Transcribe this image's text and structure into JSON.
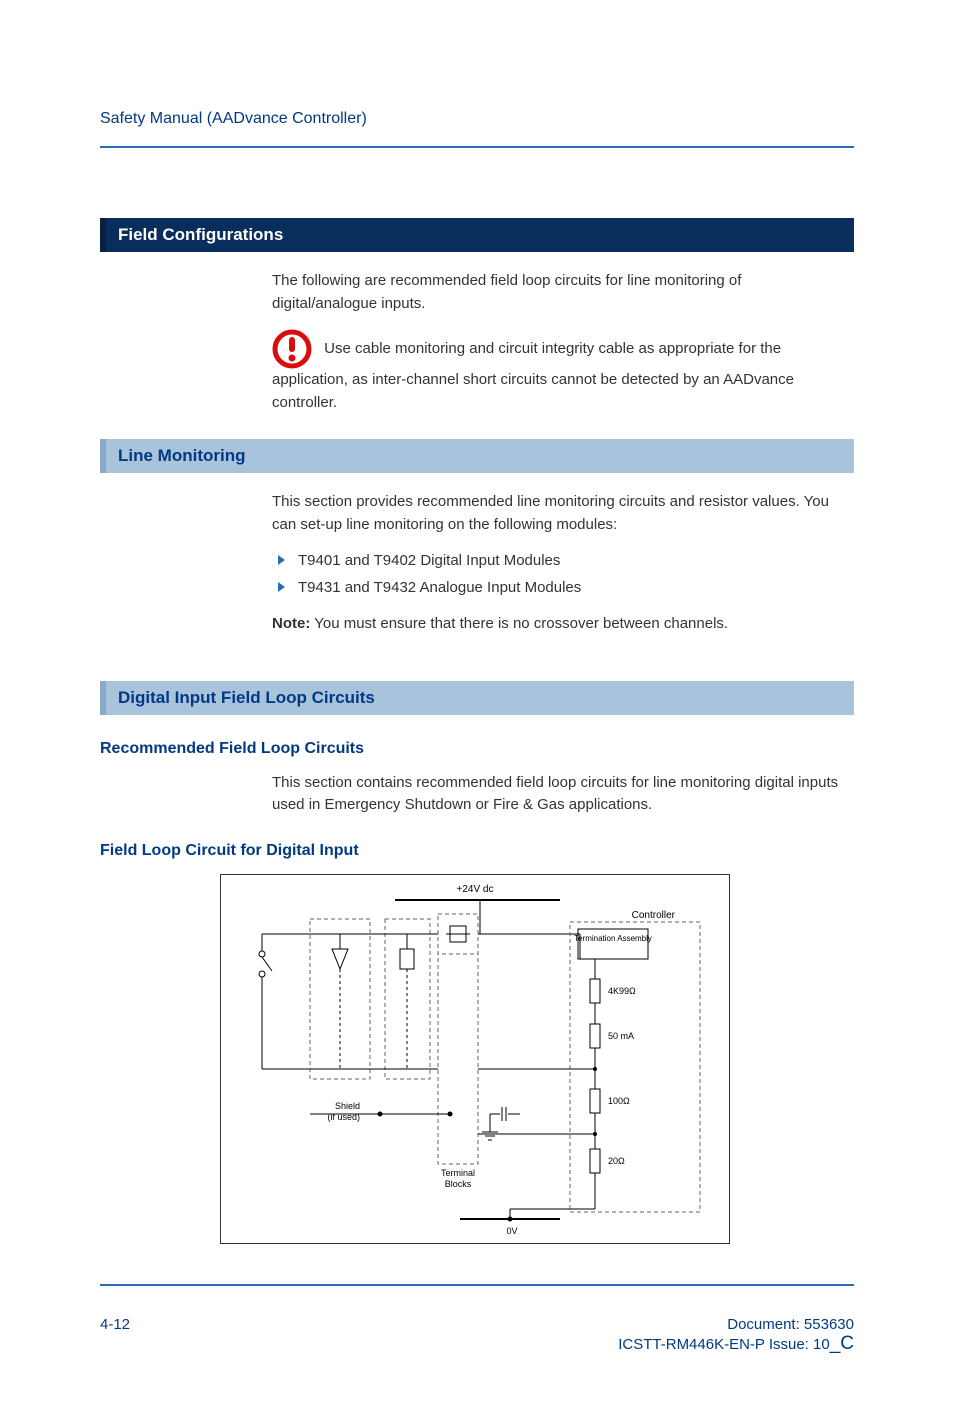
{
  "header": {
    "title": "Safety Manual (AADvance Controller)"
  },
  "sections": {
    "field_config": {
      "heading": "Field Configurations",
      "intro": "The following are recommended field loop circuits for line monitoring of digital/analogue inputs.",
      "alert": "Use cable monitoring and circuit integrity cable as appropriate for the application, as inter-channel short circuits cannot be detected by an AADvance controller."
    },
    "line_monitoring": {
      "heading": "Line Monitoring",
      "intro": "This section provides recommended line monitoring circuits and resistor values. You can set-up line monitoring on the following modules:",
      "bullets": [
        "T9401 and T9402 Digital Input Modules",
        "T9431 and T9432 Analogue Input Modules"
      ],
      "note_label": "Note:",
      "note_text": " You must ensure that there is no crossover between channels."
    },
    "digital_input": {
      "heading": "Digital Input Field Loop Circuits",
      "sub1": {
        "heading": "Recommended Field Loop Circuits",
        "text": "This section contains recommended field loop circuits for line monitoring digital inputs used in Emergency Shutdown or Fire & Gas applications."
      },
      "sub2": {
        "heading": "Field Loop Circuit for Digital Input"
      }
    }
  },
  "diagram": {
    "labels": {
      "top": "+24V dc",
      "controller": "Controller",
      "termination": "Termination Assembly",
      "r1": "4K99Ω",
      "r2": "50 mA",
      "r3": "100Ω",
      "r4": "20Ω",
      "shield": "Shield",
      "shield_sub": "(if used)",
      "terminal": "Terminal",
      "terminal_sub": "Blocks",
      "bottom": "0V"
    }
  },
  "footer": {
    "page": "4-12",
    "doc_label": "Document: 553630",
    "issue_prefix": "ICSTT-RM446K-EN-P Issue: 10",
    "issue_suffix": "_C"
  }
}
